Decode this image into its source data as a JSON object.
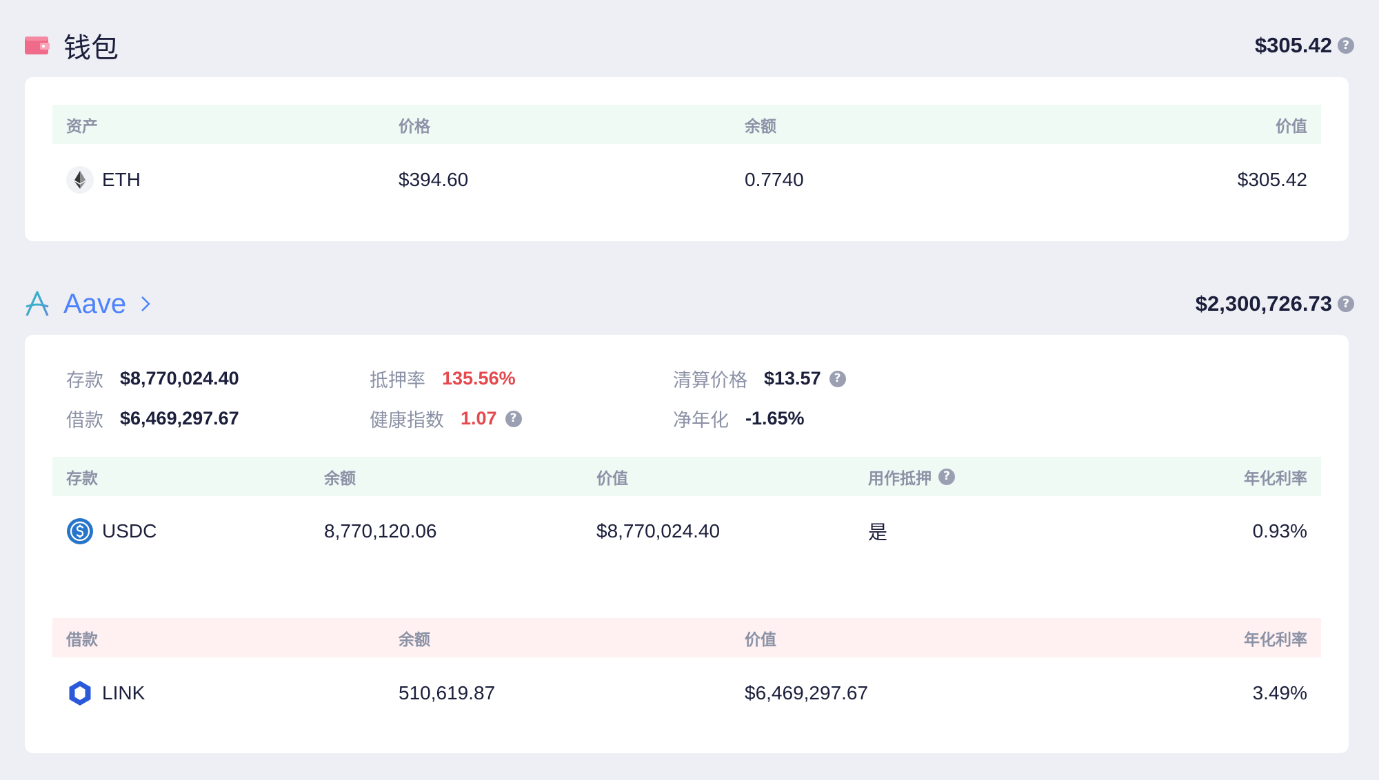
{
  "wallet": {
    "title": "钱包",
    "total": "$305.42",
    "columns": [
      "资产",
      "价格",
      "余额",
      "价值"
    ],
    "rows": [
      {
        "asset": "ETH",
        "price": "$394.60",
        "balance": "0.7740",
        "value": "$305.42",
        "icon": "eth-icon"
      }
    ]
  },
  "aave": {
    "title": "Aave",
    "total": "$2,300,726.73",
    "stats": {
      "deposit_label": "存款",
      "deposit_value": "$8,770,024.40",
      "borrow_label": "借款",
      "borrow_value": "$6,469,297.67",
      "collateral_ratio_label": "抵押率",
      "collateral_ratio_value": "135.56%",
      "health_label": "健康指数",
      "health_value": "1.07",
      "liq_price_label": "清算价格",
      "liq_price_value": "$13.57",
      "net_apy_label": "净年化",
      "net_apy_value": "-1.65%"
    },
    "deposits": {
      "columns": [
        "存款",
        "余额",
        "价值",
        "用作抵押",
        "年化利率"
      ],
      "rows": [
        {
          "asset": "USDC",
          "balance": "8,770,120.06",
          "value": "$8,770,024.40",
          "collateral": "是",
          "apy": "0.93%",
          "icon": "usdc-icon"
        }
      ]
    },
    "borrows": {
      "columns": [
        "借款",
        "余额",
        "价值",
        "年化利率"
      ],
      "rows": [
        {
          "asset": "LINK",
          "balance": "510,619.87",
          "value": "$6,469,297.67",
          "apy": "3.49%",
          "icon": "link-icon"
        }
      ]
    }
  },
  "colors": {
    "background": "#eeeff4",
    "accent_blue": "#4c82fb",
    "negative_red": "#e5484d",
    "deposit_header": "#f0faf5",
    "borrow_header": "#fff1f1",
    "wallet_icon": "#f06b8a"
  }
}
